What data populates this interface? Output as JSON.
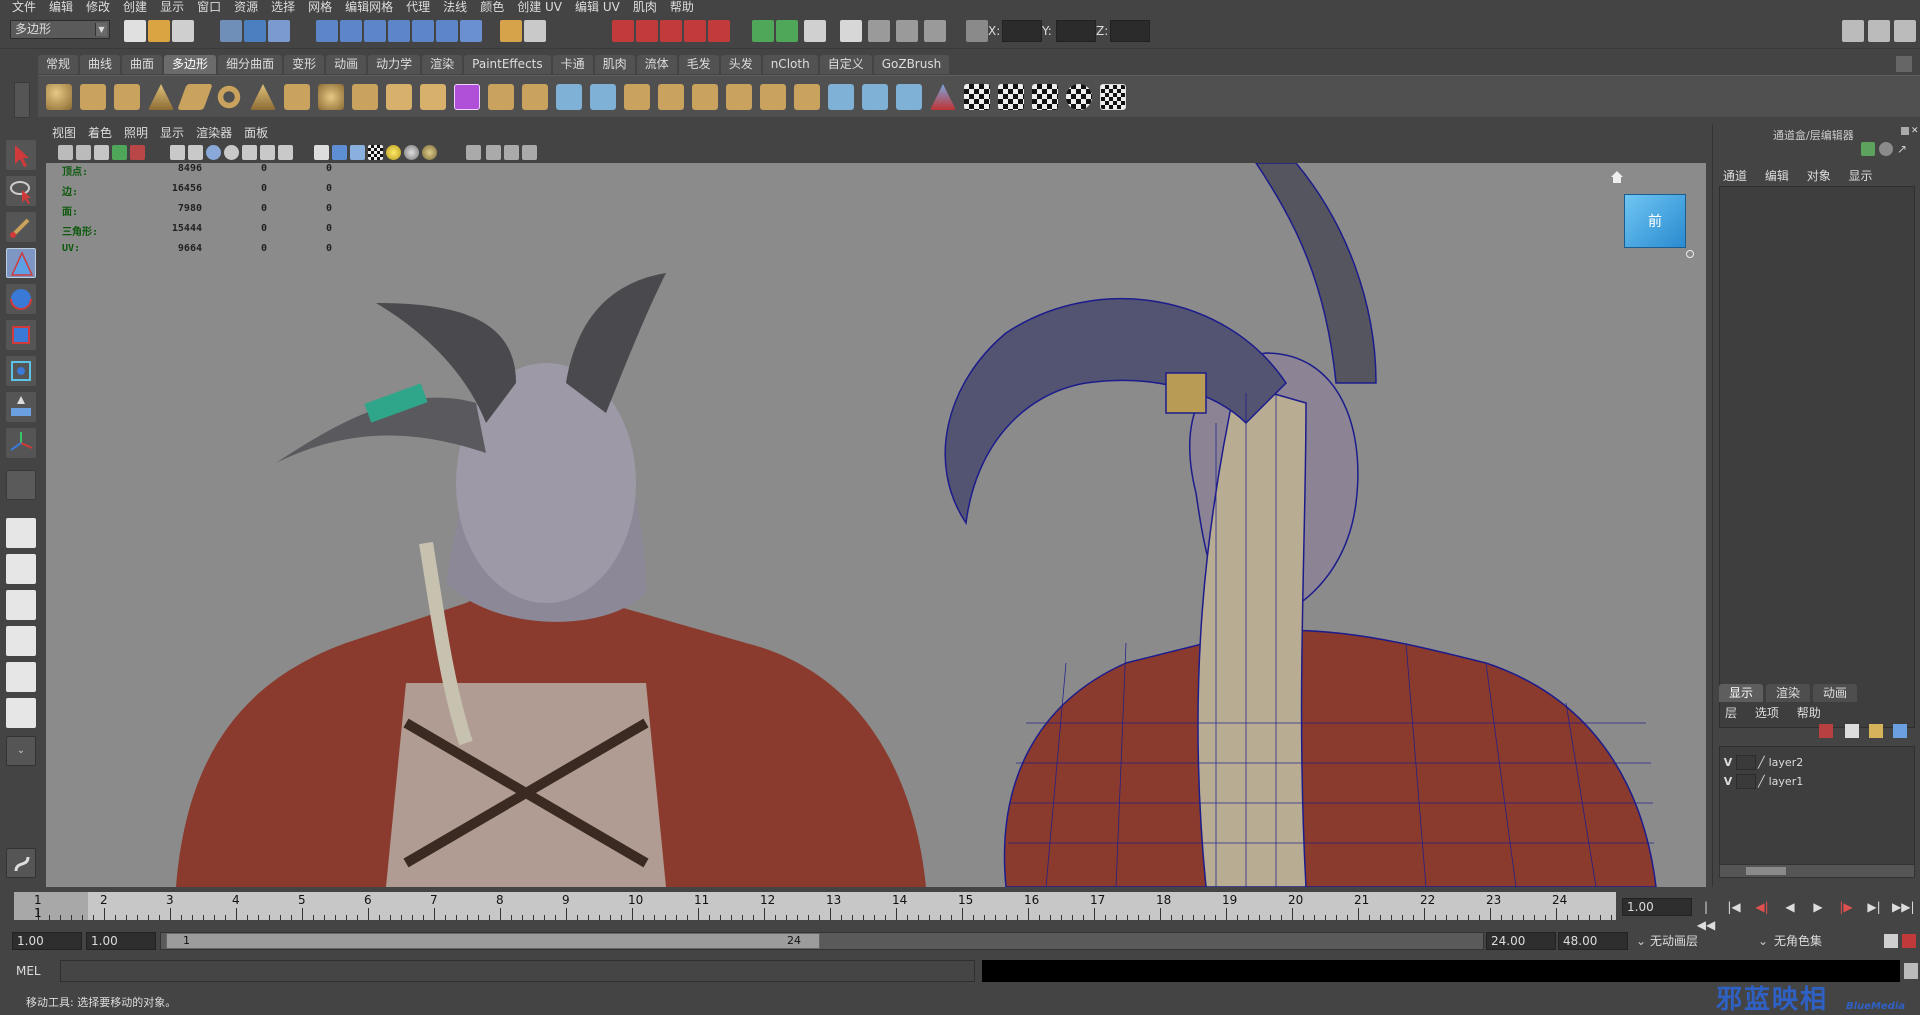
{
  "menubar": [
    "文件",
    "编辑",
    "修改",
    "创建",
    "显示",
    "窗口",
    "资源",
    "选择",
    "网格",
    "编辑网格",
    "代理",
    "法线",
    "颜色",
    "创建 UV",
    "编辑 UV",
    "肌肉",
    "帮助"
  ],
  "status": {
    "mode": "多边形",
    "x_label": "X:",
    "y_label": "Y:",
    "z_label": "Z:"
  },
  "shelf_tabs": [
    "常规",
    "曲线",
    "曲面",
    "多边形",
    "细分曲面",
    "变形",
    "动画",
    "动力学",
    "渲染",
    "PaintEffects",
    "卡通",
    "肌肉",
    "流体",
    "毛发",
    "头发",
    "nCloth",
    "自定义",
    "GoZBrush"
  ],
  "shelf_active": "多边形",
  "viewport_menu": [
    "视图",
    "着色",
    "照明",
    "显示",
    "渲染器",
    "面板"
  ],
  "hud": [
    {
      "label": "顶点:",
      "v1": "8496",
      "v2": "0",
      "v3": "0"
    },
    {
      "label": "边:",
      "v1": "16456",
      "v2": "0",
      "v3": "0"
    },
    {
      "label": "面:",
      "v1": "7980",
      "v2": "0",
      "v3": "0"
    },
    {
      "label": "三角形:",
      "v1": "15444",
      "v2": "0",
      "v3": "0"
    },
    {
      "label": "UV:",
      "v1": "9664",
      "v2": "0",
      "v3": "0"
    }
  ],
  "viewcube_label": "前",
  "right_panel": {
    "title": "通道盒/层编辑器",
    "menu": [
      "通道",
      "编辑",
      "对象",
      "显示"
    ],
    "tabs": [
      "显示",
      "渲染",
      "动画"
    ],
    "layer_menu": [
      "层",
      "选项",
      "帮助"
    ],
    "layers": [
      {
        "vis": "V",
        "name": "layer2"
      },
      {
        "vis": "V",
        "name": "layer1"
      }
    ]
  },
  "timeline": {
    "ticks": [
      "1",
      "2",
      "3",
      "4",
      "5",
      "6",
      "7",
      "8",
      "9",
      "10",
      "11",
      "12",
      "13",
      "14",
      "15",
      "16",
      "17",
      "18",
      "19",
      "20",
      "21",
      "22",
      "23",
      "24"
    ],
    "current_frame": "1",
    "current_field": "1.00"
  },
  "playback": [
    "|◀◀",
    "|◀",
    "◀|",
    "◀",
    "▶",
    "|▶",
    "▶|",
    "▶▶|"
  ],
  "range": {
    "start": "1.00",
    "anim_start": "1.00",
    "range_start": "1",
    "range_end": "24",
    "range_end_field": "24.00",
    "anim_end": "48.00",
    "anim_layer": "无动画层",
    "char_set": "无角色集"
  },
  "mel": {
    "label": "MEL"
  },
  "help_line": "移动工具: 选择要移动的对象。",
  "watermark": "邪蓝映相",
  "watermark_sub": "BlueMedia"
}
